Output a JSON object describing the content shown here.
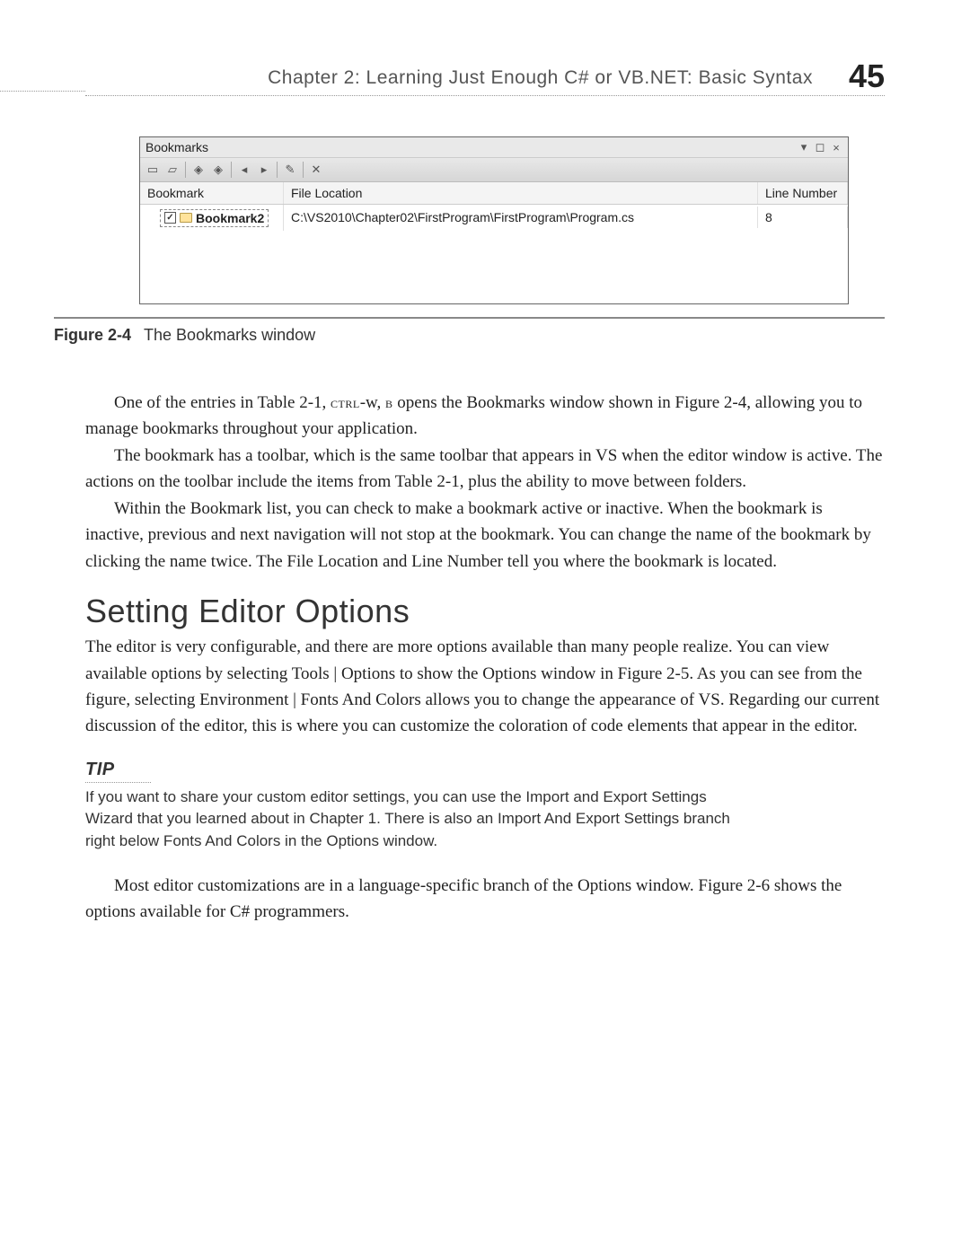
{
  "header": {
    "chapter_line": "Chapter 2:   Learning Just Enough C# or VB.NET: Basic Syntax",
    "page_number": "45"
  },
  "bookmarks_window": {
    "title": "Bookmarks",
    "buttons": {
      "dropdown": "▾",
      "restore": "◻",
      "close": "×"
    },
    "toolbar": {
      "btn1": "▭",
      "btn2": "▱",
      "btn3": "◈",
      "btn4": "◈",
      "btn5": "◂",
      "btn6": "▸",
      "btn7": "✎",
      "btn8": "✕"
    },
    "columns": {
      "bookmark": "Bookmark",
      "file_location": "File Location",
      "line_number": "Line Number"
    },
    "rows": [
      {
        "name": "Bookmark2",
        "file": "C:\\VS2010\\Chapter02\\FirstProgram\\FirstProgram\\Program.cs",
        "line": "8"
      }
    ]
  },
  "figure": {
    "label": "Figure 2-4",
    "caption": "The Bookmarks window"
  },
  "paragraphs": {
    "p1a": "One of the entries in Table 2-1, ",
    "p1_sc1": "ctrl",
    "p1b": "-w, ",
    "p1_sc2": "b",
    "p1c": " opens the Bookmarks window shown in Figure 2-4, allowing you to manage bookmarks throughout your application.",
    "p2": "The bookmark has a toolbar, which is the same toolbar that appears in VS when the editor window is active. The actions on the toolbar include the items from Table 2-1, plus the ability to move between folders.",
    "p3": "Within the Bookmark list, you can check to make a bookmark active or inactive. When the bookmark is inactive, previous and next navigation will not stop at the bookmark. You can change the name of the bookmark by clicking the name twice. The File Location and Line Number tell you where the bookmark is located."
  },
  "section_heading": "Setting Editor Options",
  "section_body": {
    "p1": "The editor is very configurable, and there are more options available than many people realize. You can view available options by selecting Tools | Options to show the Options window in Figure 2-5. As you can see from the figure, selecting Environment | Fonts And Colors allows you to change the appearance of VS. Regarding our current discussion of the editor, this is where you can customize the coloration of code elements that appear in the editor."
  },
  "tip": {
    "label": "TIP",
    "text": "If you want to share your custom editor settings, you can use the Import and Export Settings Wizard that you learned about in Chapter 1. There is also an Import And Export Settings branch right below Fonts And Colors in the Options window."
  },
  "closing": {
    "p1": "Most editor customizations are in a language-specific branch of the Options window. Figure 2-6 shows the options available for C# programmers."
  }
}
